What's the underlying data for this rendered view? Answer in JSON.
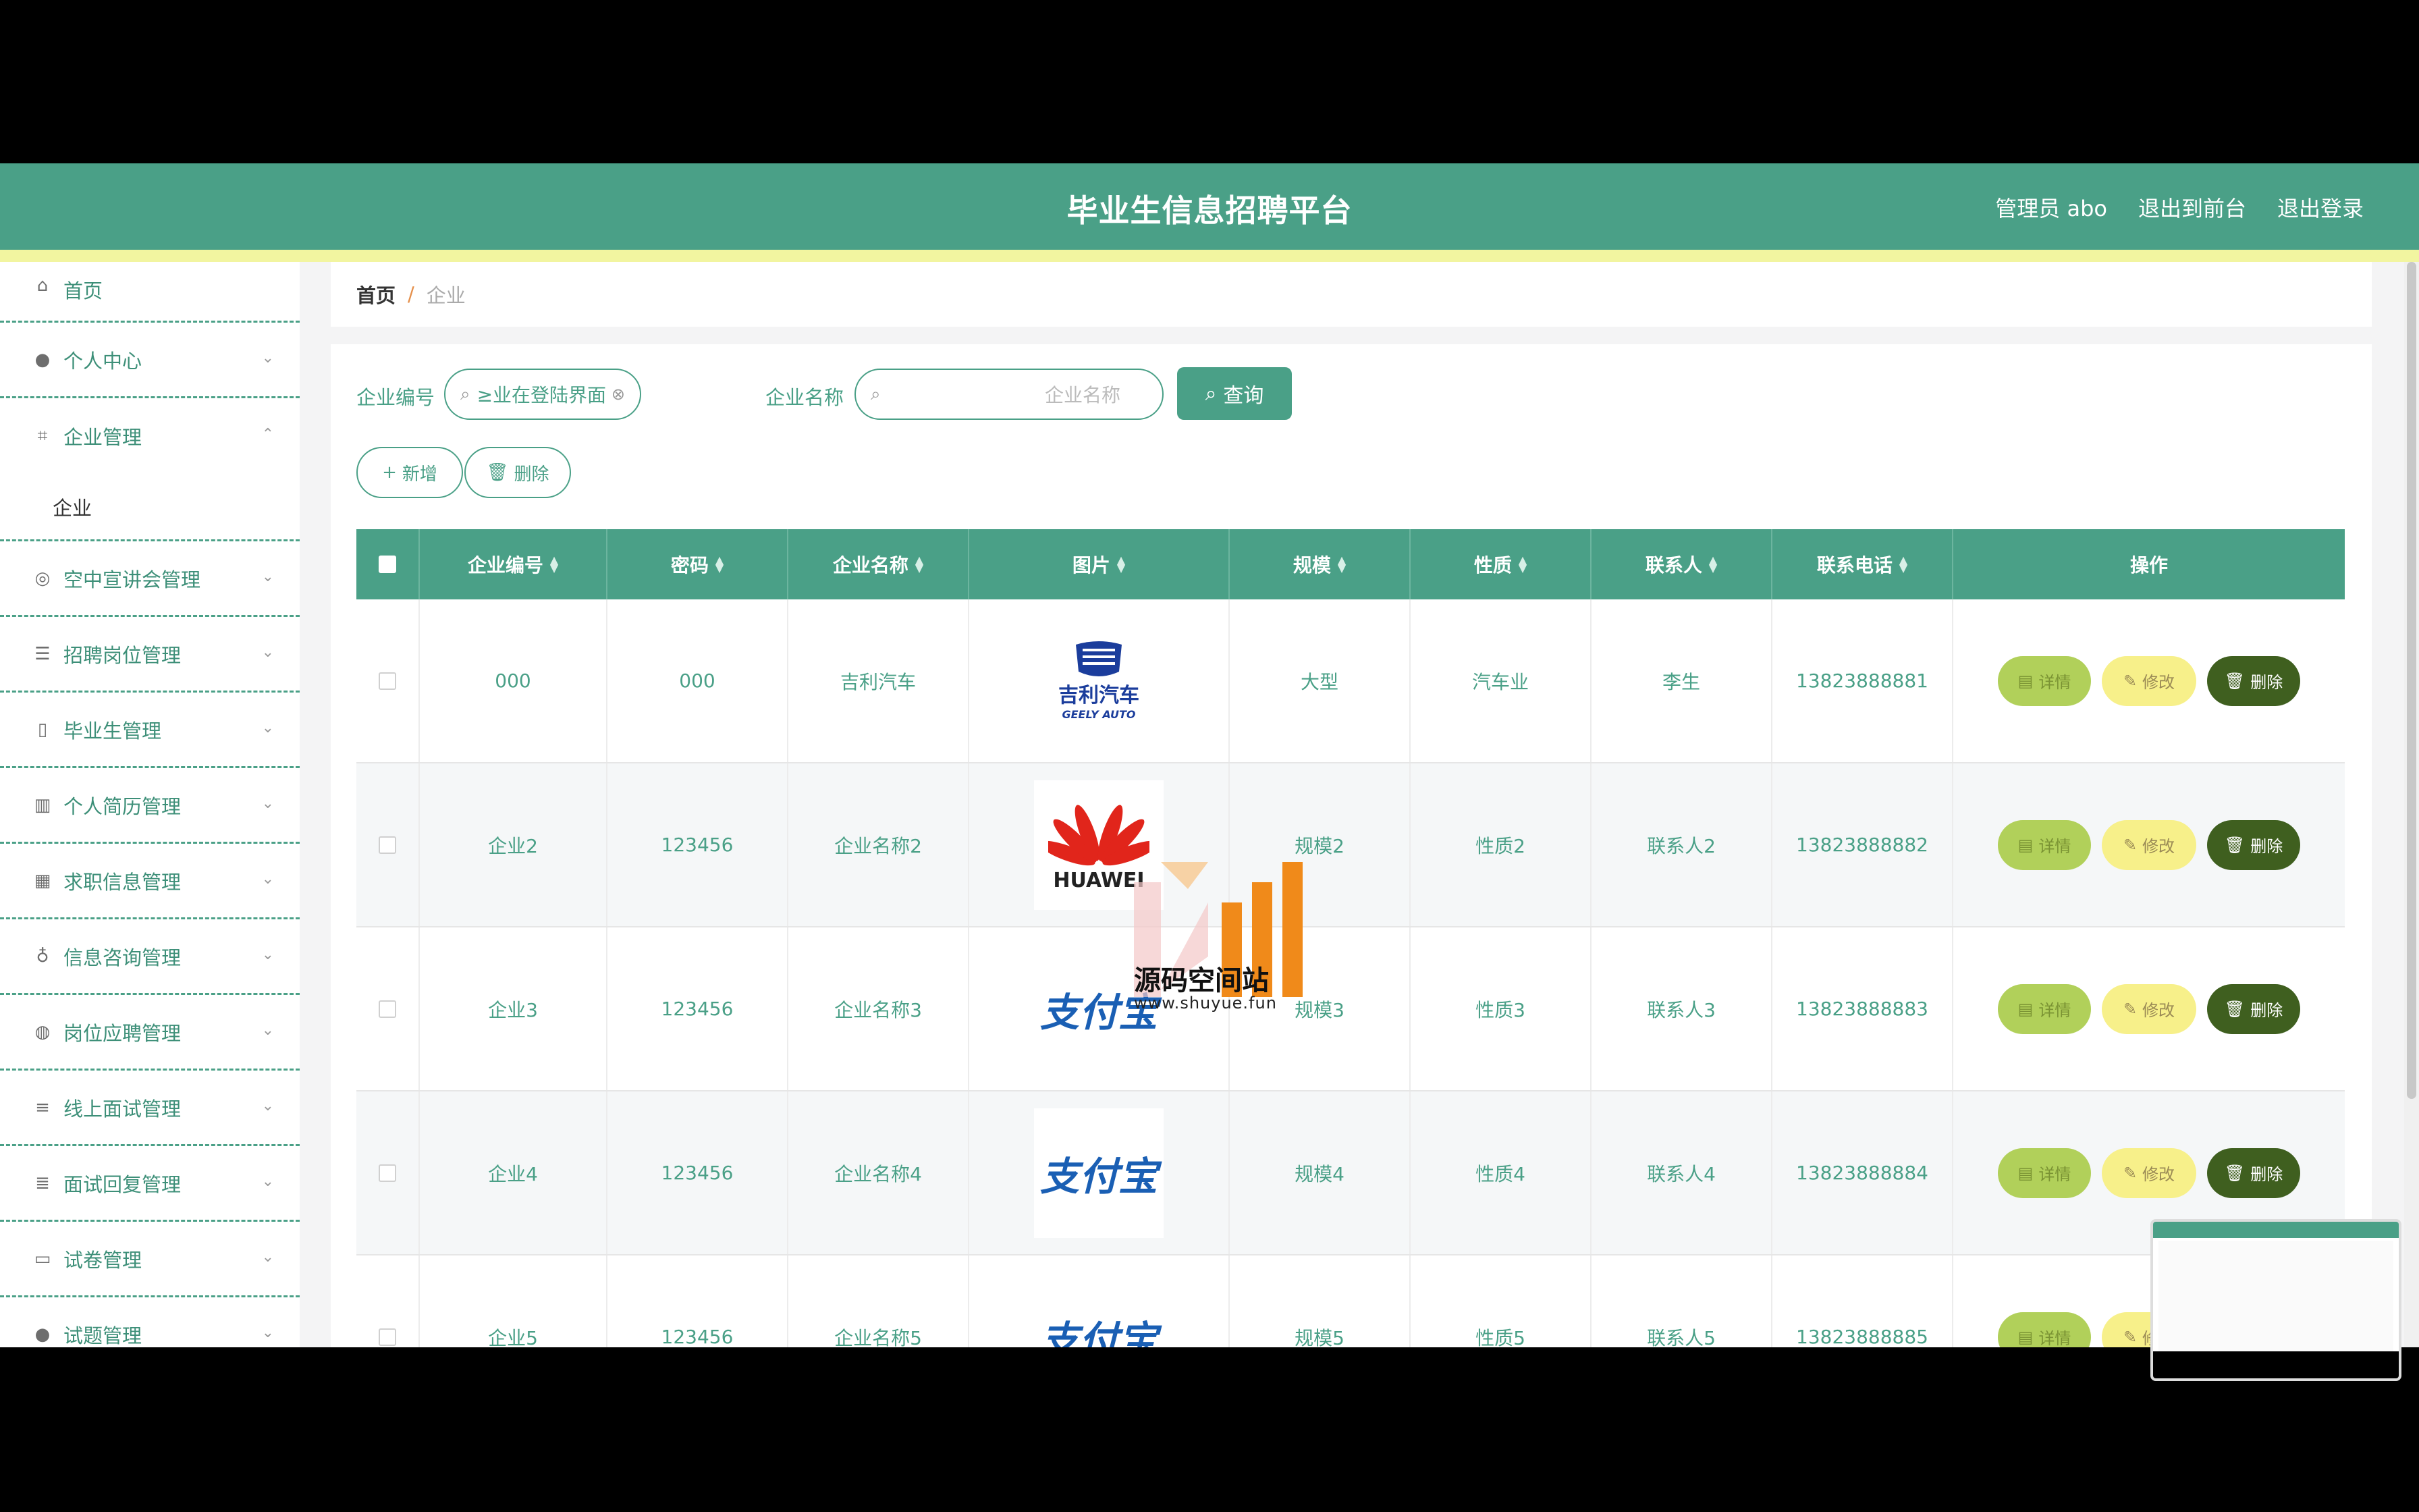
{
  "header": {
    "title": "毕业生信息招聘平台",
    "admin": "管理员 abo",
    "to_front": "退出到前台",
    "logout": "退出登录"
  },
  "sidebar": {
    "home": "首页",
    "personal": "个人中心",
    "company_mgmt": "企业管理",
    "company_sub": "企业",
    "items": [
      "空中宣讲会管理",
      "招聘岗位管理",
      "毕业生管理",
      "个人简历管理",
      "求职信息管理",
      "信息咨询管理",
      "岗位应聘管理",
      "线上面试管理",
      "面试回复管理",
      "试卷管理",
      "试题管理"
    ]
  },
  "breadcrumb": {
    "home": "首页",
    "sep": "/",
    "current": "企业"
  },
  "search": {
    "code_label": "企业编号",
    "code_value": "≥业在登陆界面可以注册账号",
    "name_label": "企业名称",
    "name_placeholder": "企业名称",
    "query": "查询"
  },
  "toolbar": {
    "add": "新增",
    "delete": "删除"
  },
  "table": {
    "headers": [
      "企业编号",
      "密码",
      "企业名称",
      "图片",
      "规模",
      "性质",
      "联系人",
      "联系电话",
      "操作"
    ],
    "rows": [
      {
        "code": "000",
        "password": "000",
        "name": "吉利汽车",
        "logo": "geely",
        "scale": "大型",
        "nature": "汽车业",
        "contact": "李生",
        "phone": "13823888881"
      },
      {
        "code": "企业2",
        "password": "123456",
        "name": "企业名称2",
        "logo": "huawei",
        "scale": "规模2",
        "nature": "性质2",
        "contact": "联系人2",
        "phone": "13823888882"
      },
      {
        "code": "企业3",
        "password": "123456",
        "name": "企业名称3",
        "logo": "alipay",
        "scale": "规模3",
        "nature": "性质3",
        "contact": "联系人3",
        "phone": "13823888883"
      },
      {
        "code": "企业4",
        "password": "123456",
        "name": "企业名称4",
        "logo": "alipay",
        "scale": "规模4",
        "nature": "性质4",
        "contact": "联系人4",
        "phone": "13823888884"
      },
      {
        "code": "企业5",
        "password": "123456",
        "name": "企业名称5",
        "logo": "alipay",
        "scale": "规模5",
        "nature": "性质5",
        "contact": "联系人5",
        "phone": "13823888885"
      }
    ],
    "ops": {
      "detail": "详情",
      "edit": "修改",
      "delete": "删除"
    }
  },
  "logos": {
    "geely_cn": "吉利汽车",
    "geely_en": "GEELY AUTO",
    "huawei": "HUAWEI",
    "alipay": "支付宝"
  },
  "watermark": {
    "text": "源码空间站",
    "url": "www.shuyue.fun"
  },
  "colors": {
    "primary": "#4aa087",
    "stripe": "#f2f5a0",
    "detail": "#b1d05a",
    "edit": "#f7f08a",
    "delete": "#3f5f1f"
  }
}
